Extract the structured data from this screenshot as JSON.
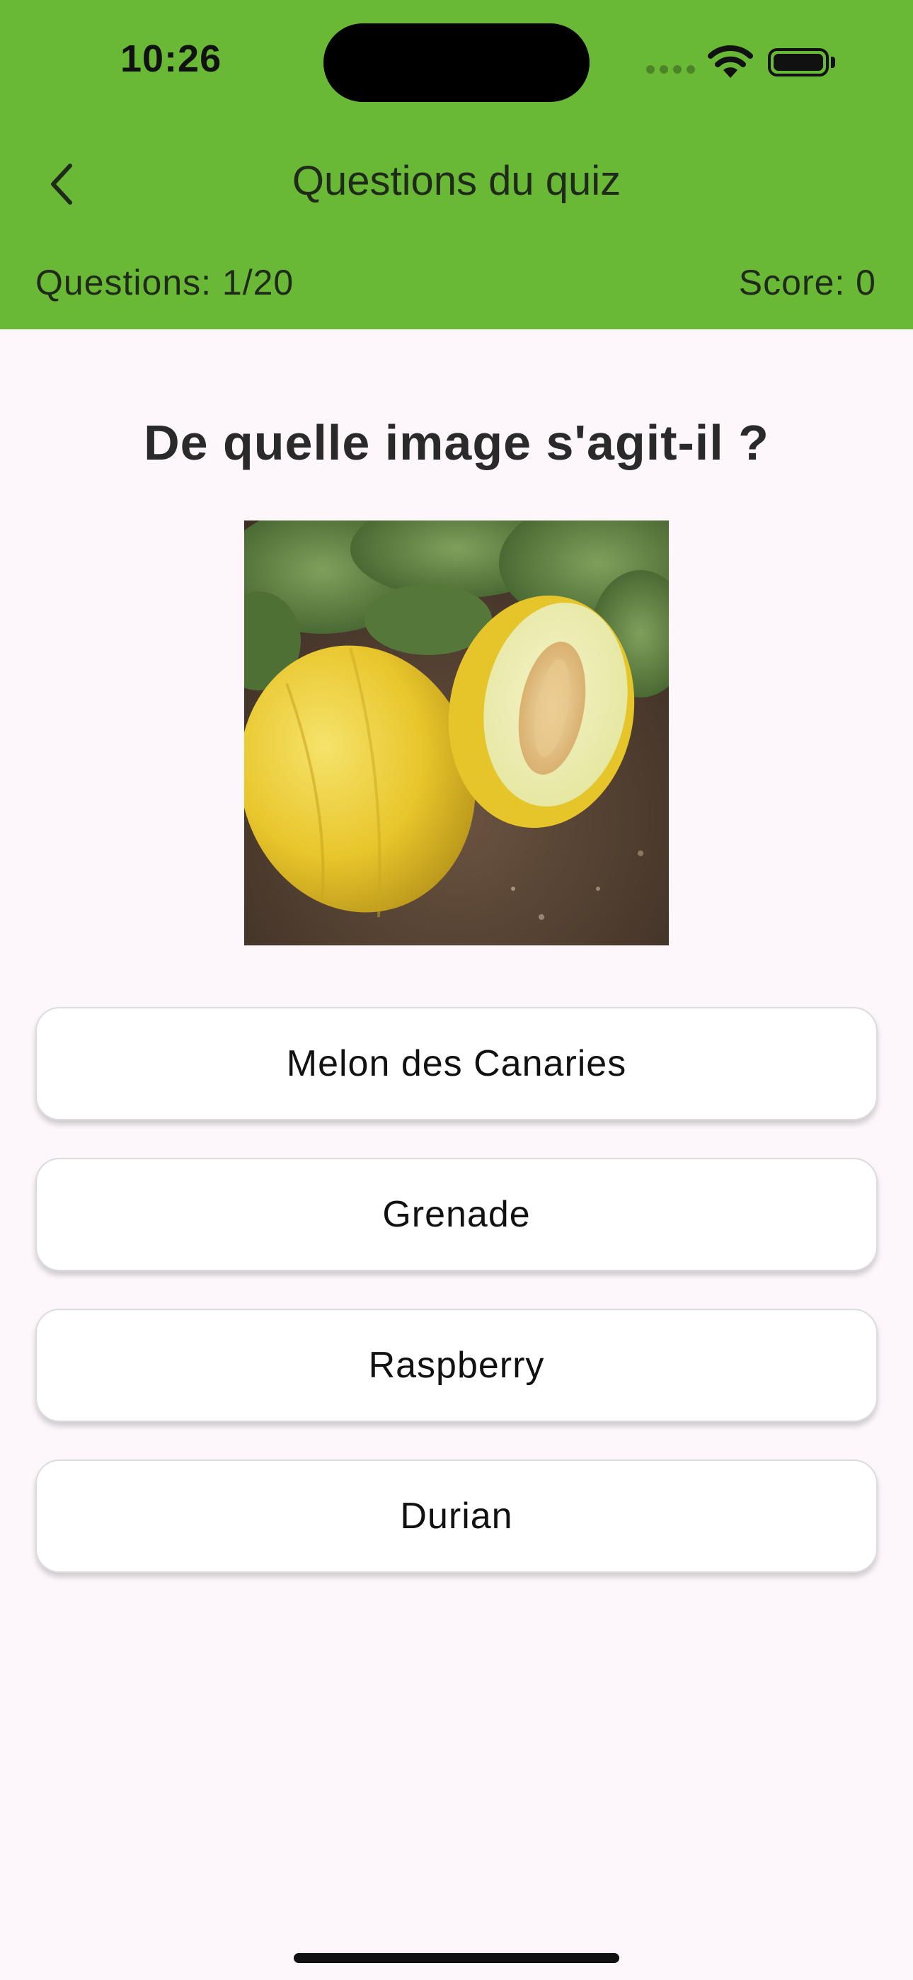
{
  "status_bar": {
    "time": "10:26"
  },
  "nav": {
    "back_icon": "chevron-left-icon",
    "title": "Questions du quiz"
  },
  "progress": {
    "questions": "Questions: 1/20",
    "score": "Score: 0"
  },
  "question": {
    "text": "De quelle image s'agit-il ?",
    "image": "melon-photo"
  },
  "answers": [
    {
      "label": "Melon des Canaries"
    },
    {
      "label": "Grenade"
    },
    {
      "label": "Raspberry"
    },
    {
      "label": "Durian"
    }
  ],
  "colors": {
    "header_green": "#6ab936",
    "background": "#fdf7fc",
    "button_bg": "#ffffff"
  }
}
